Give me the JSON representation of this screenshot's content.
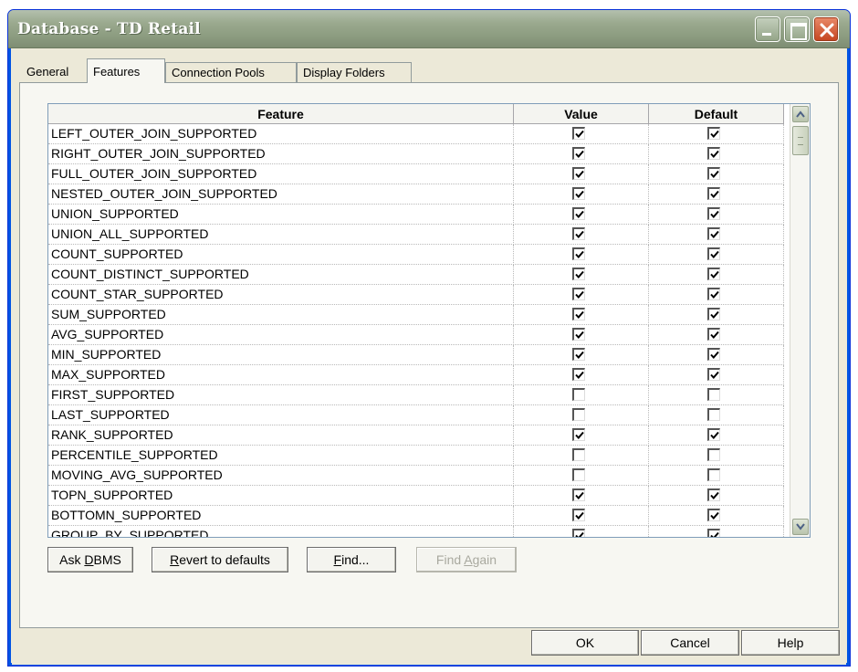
{
  "window": {
    "title": "Database - TD Retail"
  },
  "tabs": [
    {
      "label": "General"
    },
    {
      "label": "Features"
    },
    {
      "label": "Connection Pools"
    },
    {
      "label": "Display Folders"
    }
  ],
  "grid": {
    "columns": [
      "Feature",
      "Value",
      "Default"
    ],
    "rows": [
      {
        "feature": "LEFT_OUTER_JOIN_SUPPORTED",
        "value": true,
        "default": true
      },
      {
        "feature": "RIGHT_OUTER_JOIN_SUPPORTED",
        "value": true,
        "default": true
      },
      {
        "feature": "FULL_OUTER_JOIN_SUPPORTED",
        "value": true,
        "default": true
      },
      {
        "feature": "NESTED_OUTER_JOIN_SUPPORTED",
        "value": true,
        "default": true
      },
      {
        "feature": "UNION_SUPPORTED",
        "value": true,
        "default": true
      },
      {
        "feature": "UNION_ALL_SUPPORTED",
        "value": true,
        "default": true
      },
      {
        "feature": "COUNT_SUPPORTED",
        "value": true,
        "default": true
      },
      {
        "feature": "COUNT_DISTINCT_SUPPORTED",
        "value": true,
        "default": true
      },
      {
        "feature": "COUNT_STAR_SUPPORTED",
        "value": true,
        "default": true
      },
      {
        "feature": "SUM_SUPPORTED",
        "value": true,
        "default": true
      },
      {
        "feature": "AVG_SUPPORTED",
        "value": true,
        "default": true
      },
      {
        "feature": "MIN_SUPPORTED",
        "value": true,
        "default": true
      },
      {
        "feature": "MAX_SUPPORTED",
        "value": true,
        "default": true
      },
      {
        "feature": "FIRST_SUPPORTED",
        "value": false,
        "default": false
      },
      {
        "feature": "LAST_SUPPORTED",
        "value": false,
        "default": false
      },
      {
        "feature": "RANK_SUPPORTED",
        "value": true,
        "default": true
      },
      {
        "feature": "PERCENTILE_SUPPORTED",
        "value": false,
        "default": false
      },
      {
        "feature": "MOVING_AVG_SUPPORTED",
        "value": false,
        "default": false
      },
      {
        "feature": "TOPN_SUPPORTED",
        "value": true,
        "default": true
      },
      {
        "feature": "BOTTOMN_SUPPORTED",
        "value": true,
        "default": true
      },
      {
        "feature": "GROUP_BY_SUPPORTED",
        "value": true,
        "default": true
      }
    ]
  },
  "buttons": {
    "ask_dbms": {
      "pre": "Ask ",
      "key": "D",
      "post": "BMS"
    },
    "revert": {
      "pre": "",
      "key": "R",
      "post": "evert to defaults"
    },
    "find": {
      "pre": "",
      "key": "F",
      "post": "ind..."
    },
    "find_again": {
      "pre": "Find ",
      "key": "A",
      "post": "gain"
    },
    "ok": "OK",
    "cancel": "Cancel",
    "help": "Help"
  },
  "icons": {
    "minimize": "minimize-icon",
    "maximize": "maximize-icon",
    "close": "close-icon",
    "checkbox": "checkmark-icon",
    "scroll_up": "chevron-up-icon",
    "scroll_down": "chevron-down-icon"
  },
  "colors": {
    "titlebar": "#9aa98e",
    "window_face": "#ece9d8",
    "close_button": "#c5451f"
  }
}
